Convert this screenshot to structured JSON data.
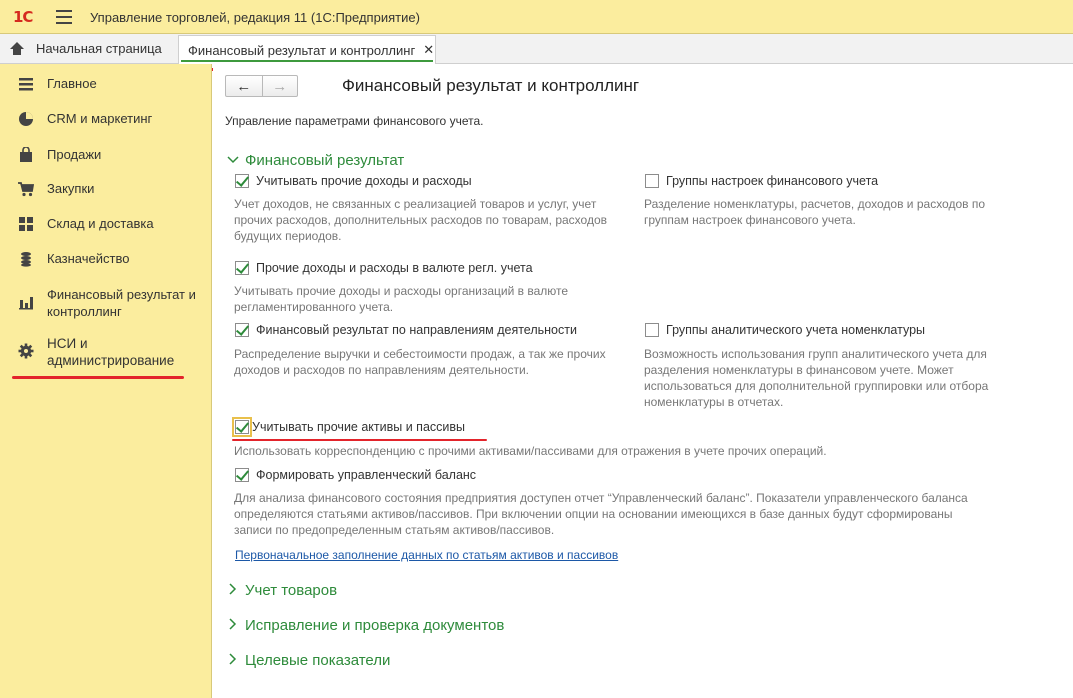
{
  "app": {
    "logo": "1С",
    "title": "Управление торговлей, редакция 11  (1С:Предприятие)"
  },
  "tabs": {
    "home_label": "Начальная страница",
    "active_label": "Финансовый результат и контроллинг",
    "close_glyph": "✕"
  },
  "sidebar": {
    "items": [
      {
        "label": "Главное",
        "icon": "list-icon"
      },
      {
        "label": "CRM и маркетинг",
        "icon": "pie-chart-icon"
      },
      {
        "label": "Продажи",
        "icon": "shopping-bag-icon"
      },
      {
        "label": "Закупки",
        "icon": "cart-icon"
      },
      {
        "label": "Склад и доставка",
        "icon": "warehouse-icon"
      },
      {
        "label": "Казначейство",
        "icon": "coins-icon"
      },
      {
        "label": "Финансовый результат и контроллинг",
        "icon": "bar-chart-icon"
      },
      {
        "label": "НСИ и администрирование",
        "icon": "gear-icon"
      }
    ]
  },
  "main": {
    "nav_back": "←",
    "nav_forward": "→",
    "title": "Финансовый результат и контроллинг",
    "subtitle": "Управление параметрами финансового учета.",
    "sections": {
      "fin_result": "Финансовый результат",
      "goods": "Учет товаров",
      "docs": "Исправление и проверка документов",
      "targets": "Целевые показатели"
    },
    "options": {
      "other_income": {
        "label": "Учитывать прочие доходы и расходы",
        "checked": true,
        "desc": "Учет доходов, не связанных с реализацией товаров и услуг, учет прочих расходов, дополнительных расходов по товарам, расходов будущих периодов."
      },
      "settings_groups": {
        "label": "Группы настроек финансового учета",
        "checked": false,
        "desc": "Разделение номенклатуры, расчетов, доходов и расходов по группам настроек финансового учета."
      },
      "other_income_currency": {
        "label": "Прочие доходы и расходы в валюте регл. учета",
        "checked": true,
        "desc": "Учитывать прочие доходы и расходы организаций в валюте регламентированного учета."
      },
      "fin_result_directions": {
        "label": "Финансовый результат по направлениям деятельности",
        "checked": true,
        "desc": "Распределение выручки и себестоимости продаж, а так же прочих доходов и расходов по направлениям деятельности."
      },
      "analytic_groups": {
        "label": "Группы аналитического учета номенклатуры",
        "checked": false,
        "desc": "Возможность использования групп аналитического учета для разделения номенклатуры в финансовом учете. Может использоваться для дополнительной группировки или отбора номенклатуры в отчетах."
      },
      "other_assets": {
        "label": "Учитывать прочие активы и пассивы",
        "checked": true,
        "desc": "Использовать корреспонденцию с прочими активами/пассивами для отражения в учете прочих операций."
      },
      "mgmt_balance": {
        "label": "Формировать управленческий баланс",
        "checked": true,
        "desc": "Для анализа финансового состояния предприятия доступен отчет “Управленческий баланс”. Показатели управленческого баланса определяются статьями активов/пассивов. При включении опции на основании имеющихся в базе данных будут сформированы записи по предопределенным статьям активов/пассивов."
      }
    },
    "link": "Первоначальное заполнение данных по статьям активов и пассивов"
  },
  "colors": {
    "panel_yellow": "#fbed9e",
    "accent_green": "#2e8b3b",
    "link_blue": "#1c58a7",
    "annotation_red": "#e3242b"
  }
}
